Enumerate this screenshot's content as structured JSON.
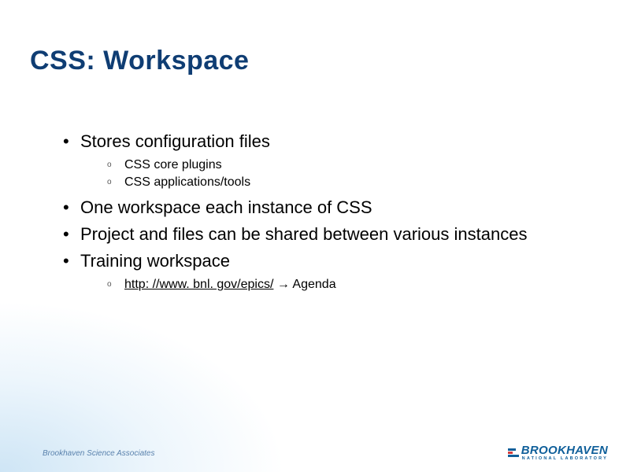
{
  "title": "CSS: Workspace",
  "bullets": {
    "b0": {
      "text": "Stores configuration files"
    },
    "b0s": {
      "s0": "CSS core plugins",
      "s1": "CSS applications/tools"
    },
    "b1": {
      "text": "One workspace each instance of CSS"
    },
    "b2": {
      "text": "Project and files can be shared between various instances"
    },
    "b3": {
      "text": "Training workspace"
    },
    "b3s": {
      "link": "http: //www. bnl. gov/epics/",
      "tail": " → Agenda"
    }
  },
  "footer": {
    "left": "Brookhaven Science Associates",
    "logo_name": "BROOKHAVEN",
    "logo_sub": "NATIONAL LABORATORY"
  }
}
